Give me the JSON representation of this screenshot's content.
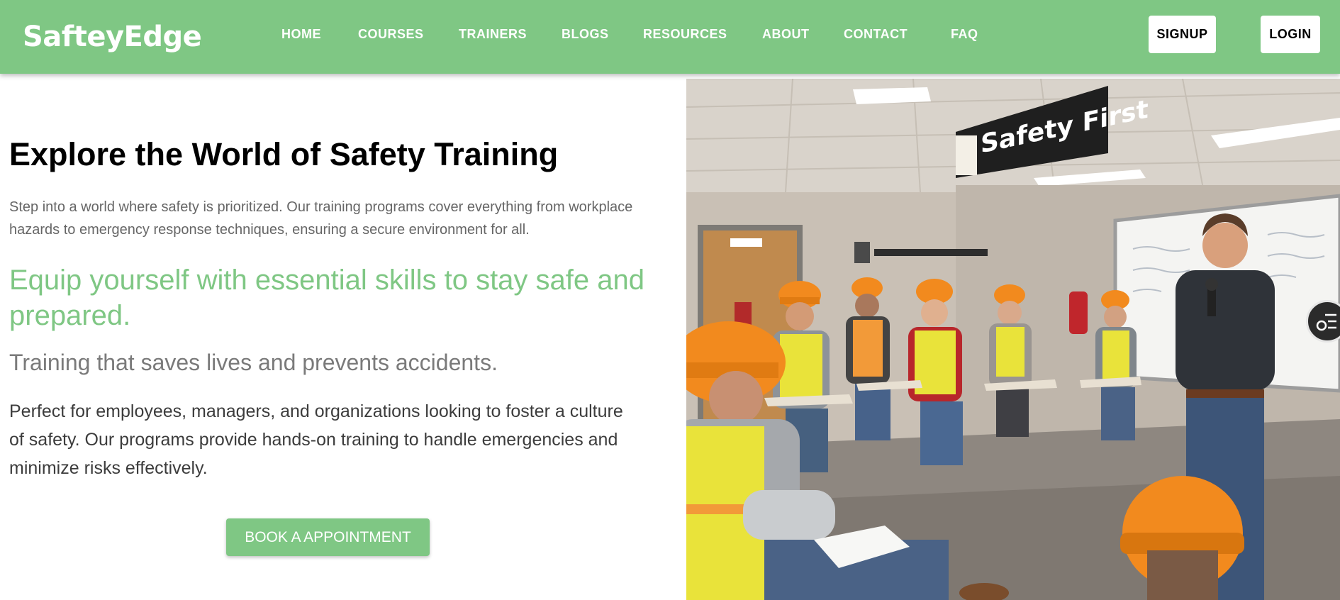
{
  "brand": {
    "name": "SafteyEdge"
  },
  "nav": {
    "items": [
      {
        "label": "HOME"
      },
      {
        "label": "COURSES"
      },
      {
        "label": "TRAINERS"
      },
      {
        "label": "BLOGS"
      },
      {
        "label": "RESOURCES"
      },
      {
        "label": "ABOUT"
      },
      {
        "label": "CONTACT"
      },
      {
        "label": "FAQ"
      }
    ]
  },
  "auth": {
    "signup_label": "SIGNUP",
    "login_label": "LOGIN"
  },
  "hero": {
    "title": "Explore the World of Safety Training",
    "intro": "Step into a world where safety is prioritized. Our training programs cover everything from workplace hazards to emergency response techniques, ensuring a secure environment for all.",
    "tagline": "Equip yourself with essential skills to stay safe and prepared.",
    "subheading": "Training that saves lives and prevents accidents.",
    "body": "Perfect for employees, managers, and organizations looking to foster a culture of safety. Our programs provide hands-on training to handle emergencies and minimize risks effectively.",
    "cta_label": "BOOK A APPOINTMENT",
    "image": {
      "sign_text": "Safety First"
    }
  },
  "colors": {
    "accent": "#7fc784",
    "header_text": "#ffffff",
    "hardhat": "#f28a1e",
    "vest": "#e9e33a"
  },
  "icons": {
    "floating_widget": "list-menu-icon"
  }
}
